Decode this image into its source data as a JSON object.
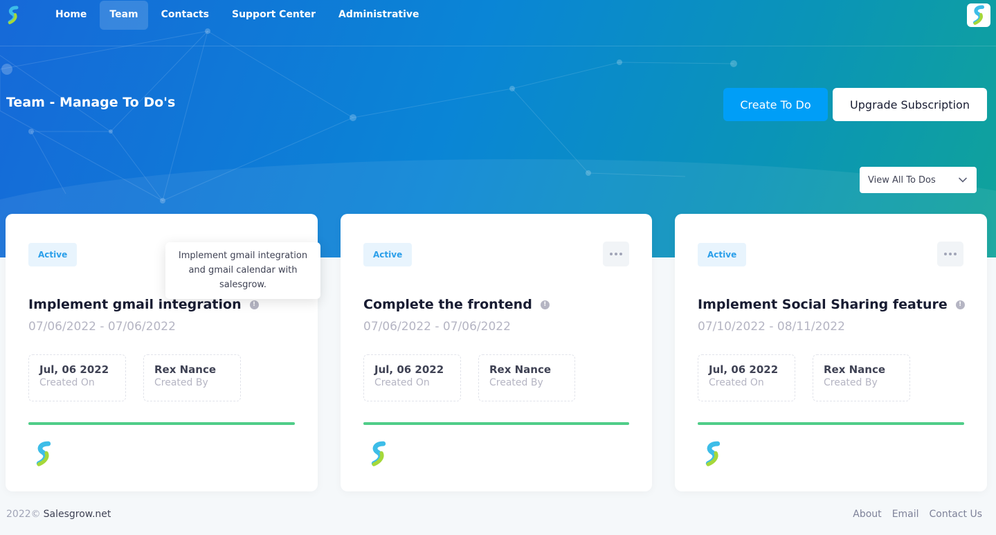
{
  "nav": {
    "items": [
      "Home",
      "Team",
      "Contacts",
      "Support Center",
      "Administrative"
    ],
    "active": "Team"
  },
  "header": {
    "title": "Team - Manage To Do's",
    "create_button": "Create To Do",
    "upgrade_button": "Upgrade Subscription",
    "filter_select": "View All To Dos"
  },
  "tooltip": "Implement gmail integration and gmail calendar with salesgrow.",
  "cards": [
    {
      "status": "Active",
      "title": "Implement gmail integration",
      "dates": "07/06/2022 - 07/06/2022",
      "created_on": "Jul, 06 2022",
      "created_on_label": "Created On",
      "created_by": "Rex Nance",
      "created_by_label": "Created By",
      "progress": 1.0
    },
    {
      "status": "Active",
      "title": "Complete the frontend",
      "dates": "07/06/2022 - 07/06/2022",
      "created_on": "Jul, 06 2022",
      "created_on_label": "Created On",
      "created_by": "Rex Nance",
      "created_by_label": "Created By",
      "progress": 1.0
    },
    {
      "status": "Active",
      "title": "Implement Social Sharing feature",
      "dates": "07/10/2022 - 08/11/2022",
      "created_on": "Jul, 06 2022",
      "created_on_label": "Created On",
      "created_by": "Rex Nance",
      "created_by_label": "Created By",
      "progress": 1.0
    }
  ],
  "footer": {
    "year": "2022©",
    "site": "Salesgrow.net",
    "links": [
      "About",
      "Email",
      "Contact Us"
    ]
  },
  "colors": {
    "primary": "#009ef7",
    "success": "#50cd89",
    "badge_bg": "#e8f4fd",
    "badge_text": "#2b9fea"
  },
  "icons": {
    "brand": "salesgrow-logo-icon",
    "menu": "more-horizontal-icon",
    "info": "info-icon",
    "chevron": "chevron-down-icon"
  }
}
